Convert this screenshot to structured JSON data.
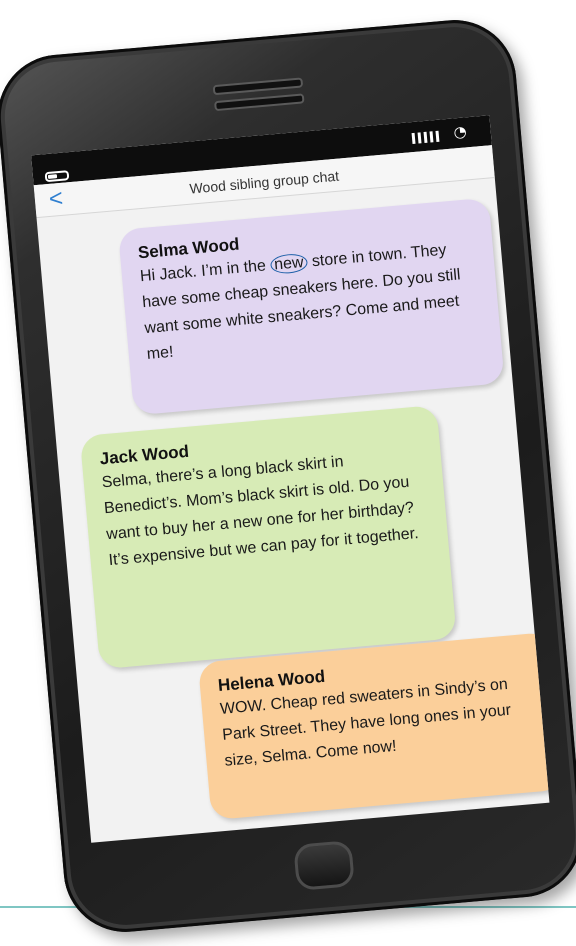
{
  "header": {
    "title": "Wood sibling group chat"
  },
  "status_bar": {
    "battery_icon": "battery-icon",
    "signal_icon": "signal-bars-icon",
    "wifi_icon": "wifi-icon"
  },
  "navigation": {
    "back_icon": "chevron-left-icon",
    "back_glyph": "<"
  },
  "messages": [
    {
      "sender": "Selma Wood",
      "text_before": "Hi Jack. I’m in the",
      "highlighted_word": "new",
      "text_after": "store in town. They have some cheap sneakers here. Do you still want some white sneakers? Come and meet me!",
      "color": "#e1d6f1"
    },
    {
      "sender": "Jack Wood",
      "text": "Selma, there’s a long black skirt in Benedict’s. Mom’s black skirt is old. Do you want to buy her a new one for her birthday? It’s expensive but we can pay for it together.",
      "color": "#d7ebb6"
    },
    {
      "sender": "Helena Wood",
      "text": "WOW. Cheap red sweaters in Sindy’s on Park Street. They have long ones in your size, Selma. Come now!",
      "color": "#fbcf9a"
    }
  ],
  "accent_color": "#2f7fd0"
}
